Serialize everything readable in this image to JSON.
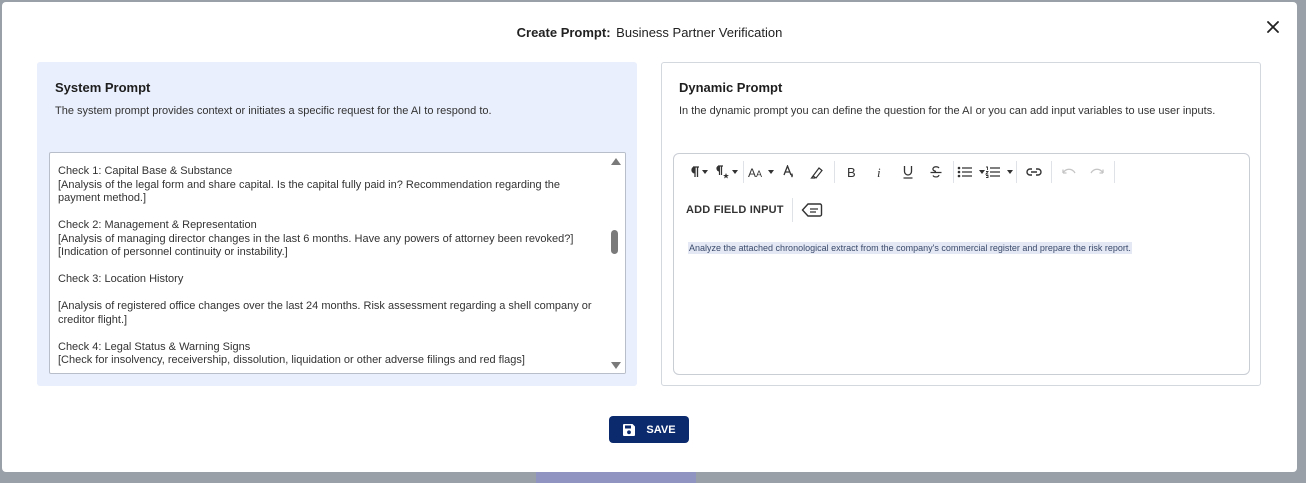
{
  "modal": {
    "title_label": "Create Prompt:",
    "title_value": "Business Partner Verification",
    "close_icon": "close-icon"
  },
  "system_prompt": {
    "heading": "System Prompt",
    "description": "The system prompt provides context or initiates a specific request for the AI to respond to.",
    "text": "Check 1: Capital Base & Substance\n[Analysis of the legal form and share capital. Is the capital fully paid in? Recommendation regarding the payment method.]\n\nCheck 2: Management & Representation\n[Analysis of managing director changes in the last 6 months. Have any powers of attorney been revoked?] [Indication of personnel continuity or instability.]\n\nCheck 3: Location History\n\n[Analysis of registered office changes over the last 24 months. Risk assessment regarding a shell company or creditor flight.]\n\nCheck 4: Legal Status & Warning Signs\n[Check for insolvency, receivership, dissolution, liquidation or other adverse filings and red flags]"
  },
  "dynamic_prompt": {
    "heading": "Dynamic Prompt",
    "description": "In the dynamic prompt you can define the question for the AI or you can add input variables to use user inputs.",
    "toolbar": {
      "icons": [
        "paragraph-format-icon",
        "paragraph-style-icon",
        "font-size-icon",
        "text-color-icon",
        "highlight-icon",
        "bold-icon",
        "italic-icon",
        "underline-icon",
        "strikethrough-icon",
        "bullet-list-icon",
        "numbered-list-icon",
        "link-icon",
        "undo-icon",
        "redo-icon"
      ]
    },
    "add_field_input_label": "ADD FIELD INPUT",
    "content": "Analyze the attached chronological extract from the company's commercial register and prepare the risk report."
  },
  "save_button": {
    "label": "SAVE",
    "icon": "save-icon"
  },
  "colors": {
    "primary": "#0b2a6e",
    "system_panel_bg": "#e9effc"
  }
}
